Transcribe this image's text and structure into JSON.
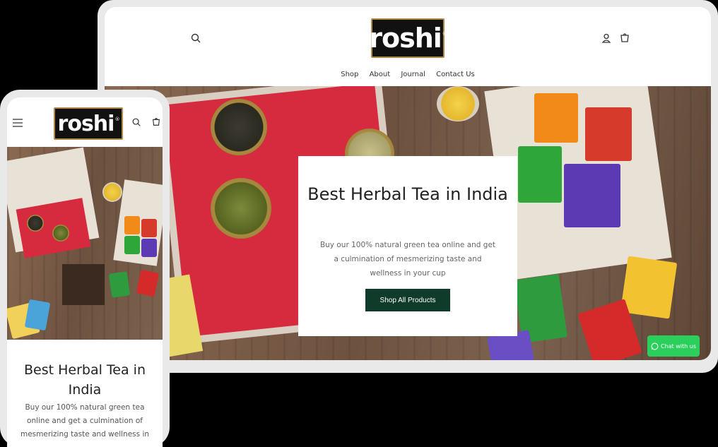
{
  "brand": {
    "logo_text": "roshi",
    "logo_mark": "®"
  },
  "desktop": {
    "nav": [
      "Shop",
      "About",
      "Journal",
      "Contact Us"
    ],
    "hero": {
      "title": "Best Herbal Tea in India",
      "description": "Buy our 100% natural green tea online and get a culmination of mesmerizing taste and wellness in your cup",
      "cta_label": "Shop All Products"
    },
    "chat_label": "Chat with us",
    "icons": [
      "search-icon",
      "account-icon",
      "cart-icon",
      "whatsapp-icon"
    ]
  },
  "mobile": {
    "hero": {
      "title": "Best Herbal Tea in India",
      "description": "Buy our 100% natural green tea online and get a culmination of mesmerizing taste and wellness in"
    },
    "icons": [
      "menu-icon",
      "search-icon",
      "cart-icon"
    ]
  },
  "colors": {
    "cta_bg": "#0f3b2a",
    "chat_bg": "#2bcf5c",
    "logo_bg": "#111111",
    "logo_border": "#b08a4a",
    "frame": "#e9e9e9"
  }
}
